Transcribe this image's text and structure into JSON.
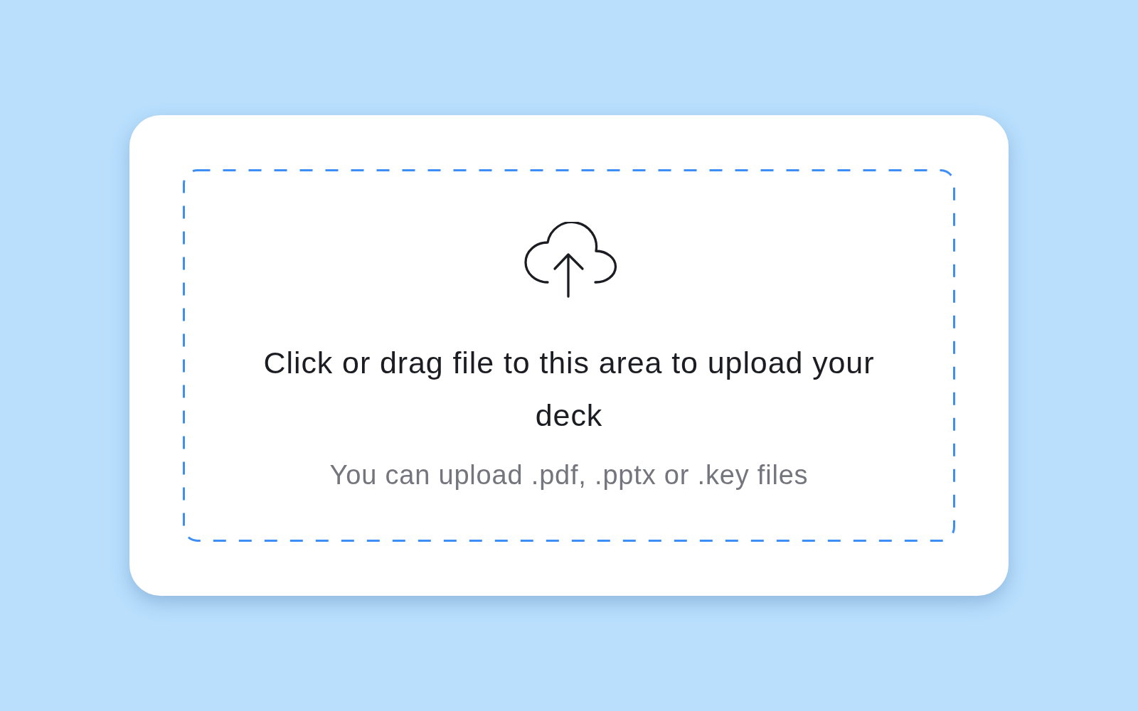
{
  "upload_area": {
    "title": "Click or drag file to this area to upload your deck",
    "hint": "You can upload .pdf, .pptx or .key files"
  }
}
